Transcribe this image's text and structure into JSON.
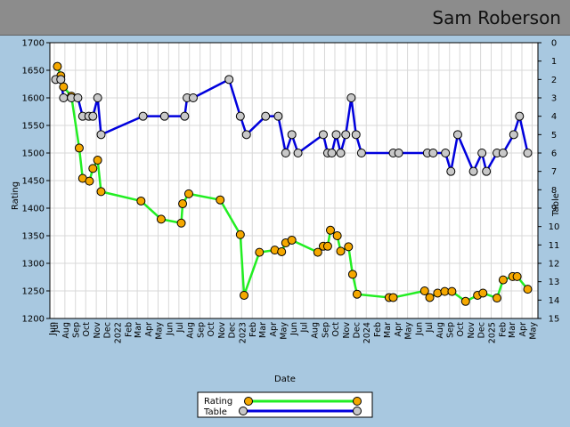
{
  "header": {
    "title": "Sam Roberson"
  },
  "chart_data": {
    "type": "line",
    "xlabel": "Date",
    "ylabel_left": "Rating",
    "ylabel_right": "Table",
    "ylim_left": [
      1200,
      1700
    ],
    "ylim_right": [
      15,
      0
    ],
    "grid": true,
    "legend_position": "bottom-center",
    "x_tick_labels": [
      "Jun",
      "Jul",
      "Aug",
      "Sep",
      "Oct",
      "Nov",
      "Dec",
      "2022",
      "Feb",
      "Mar",
      "Apr",
      "May",
      "Jun",
      "Jul",
      "Aug",
      "Sep",
      "Oct",
      "Nov",
      "Dec",
      "2023",
      "Feb",
      "Mar",
      "Apr",
      "May",
      "Jun",
      "Jul",
      "Aug",
      "Sep",
      "Oct",
      "Nov",
      "Dec",
      "2024",
      "Feb",
      "Mar",
      "Apr",
      "May",
      "Jun",
      "Jul",
      "Aug",
      "Sep",
      "Oct",
      "Nov",
      "Dec",
      "2025",
      "Feb",
      "Mar",
      "Apr",
      "May"
    ],
    "y_ticks_left": [
      1200,
      1250,
      1300,
      1350,
      1400,
      1450,
      1500,
      1550,
      1600,
      1650,
      1700
    ],
    "y_ticks_right": [
      0,
      1,
      2,
      3,
      4,
      5,
      6,
      7,
      8,
      9,
      10,
      11,
      12,
      13,
      14,
      15
    ],
    "series": [
      {
        "name": "Rating",
        "axis": "left",
        "line_color": "#22ee22",
        "marker_color": "#f5a800",
        "points": [
          [
            "2021-07-10",
            1657
          ],
          [
            "2021-07-20",
            1640
          ],
          [
            "2021-07-28",
            1620
          ],
          [
            "2021-08-20",
            1603
          ],
          [
            "2021-09-12",
            1509
          ],
          [
            "2021-09-22",
            1454
          ],
          [
            "2021-10-12",
            1449
          ],
          [
            "2021-10-22",
            1472
          ],
          [
            "2021-11-05",
            1487
          ],
          [
            "2021-11-15",
            1430
          ],
          [
            "2022-03-12",
            1413
          ],
          [
            "2022-05-10",
            1380
          ],
          [
            "2022-07-08",
            1373
          ],
          [
            "2022-07-12",
            1408
          ],
          [
            "2022-07-30",
            1426
          ],
          [
            "2022-10-30",
            1415
          ],
          [
            "2022-12-28",
            1352
          ],
          [
            "2023-01-08",
            1242
          ],
          [
            "2023-02-22",
            1320
          ],
          [
            "2023-04-08",
            1324
          ],
          [
            "2023-04-28",
            1321
          ],
          [
            "2023-05-10",
            1337
          ],
          [
            "2023-05-28",
            1342
          ],
          [
            "2023-08-12",
            1320
          ],
          [
            "2023-08-28",
            1331
          ],
          [
            "2023-09-10",
            1331
          ],
          [
            "2023-09-18",
            1360
          ],
          [
            "2023-10-08",
            1350
          ],
          [
            "2023-10-18",
            1322
          ],
          [
            "2023-11-10",
            1330
          ],
          [
            "2023-11-22",
            1280
          ],
          [
            "2023-12-05",
            1244
          ],
          [
            "2024-03-08",
            1238
          ],
          [
            "2024-03-20",
            1238
          ],
          [
            "2024-06-20",
            1250
          ],
          [
            "2024-07-05",
            1238
          ],
          [
            "2024-07-28",
            1246
          ],
          [
            "2024-08-18",
            1249
          ],
          [
            "2024-09-08",
            1249
          ],
          [
            "2024-10-18",
            1231
          ],
          [
            "2024-11-22",
            1242
          ],
          [
            "2024-12-08",
            1246
          ],
          [
            "2025-01-18",
            1237
          ],
          [
            "2025-02-05",
            1270
          ],
          [
            "2025-03-05",
            1276
          ],
          [
            "2025-03-18",
            1276
          ],
          [
            "2025-04-18",
            1253
          ]
        ]
      },
      {
        "name": "Table",
        "axis": "right",
        "line_color": "#0000dd",
        "marker_color": "#c8c8c8",
        "points": [
          [
            "2021-07-05",
            2
          ],
          [
            "2021-07-20",
            2
          ],
          [
            "2021-07-28",
            3
          ],
          [
            "2021-08-20",
            3
          ],
          [
            "2021-09-08",
            3
          ],
          [
            "2021-09-22",
            4
          ],
          [
            "2021-10-10",
            4
          ],
          [
            "2021-10-22",
            4
          ],
          [
            "2021-11-05",
            3
          ],
          [
            "2021-11-15",
            5
          ],
          [
            "2022-03-18",
            4
          ],
          [
            "2022-05-20",
            4
          ],
          [
            "2022-07-18",
            4
          ],
          [
            "2022-07-25",
            3
          ],
          [
            "2022-08-12",
            3
          ],
          [
            "2022-11-25",
            2
          ],
          [
            "2022-12-28",
            4
          ],
          [
            "2023-01-15",
            5
          ],
          [
            "2023-03-12",
            4
          ],
          [
            "2023-04-18",
            4
          ],
          [
            "2023-05-10",
            6
          ],
          [
            "2023-05-28",
            5
          ],
          [
            "2023-06-15",
            6
          ],
          [
            "2023-08-28",
            5
          ],
          [
            "2023-09-10",
            6
          ],
          [
            "2023-09-22",
            6
          ],
          [
            "2023-10-05",
            5
          ],
          [
            "2023-10-18",
            6
          ],
          [
            "2023-11-02",
            5
          ],
          [
            "2023-11-18",
            3
          ],
          [
            "2023-12-02",
            5
          ],
          [
            "2023-12-18",
            6
          ],
          [
            "2024-03-20",
            6
          ],
          [
            "2024-04-05",
            6
          ],
          [
            "2024-06-28",
            6
          ],
          [
            "2024-07-15",
            6
          ],
          [
            "2024-08-20",
            6
          ],
          [
            "2024-09-05",
            7
          ],
          [
            "2024-09-25",
            5
          ],
          [
            "2024-11-10",
            7
          ],
          [
            "2024-12-05",
            6
          ],
          [
            "2024-12-18",
            7
          ],
          [
            "2025-01-18",
            6
          ],
          [
            "2025-02-05",
            6
          ],
          [
            "2025-03-08",
            5
          ],
          [
            "2025-03-25",
            4
          ],
          [
            "2025-04-18",
            6
          ]
        ]
      }
    ]
  }
}
